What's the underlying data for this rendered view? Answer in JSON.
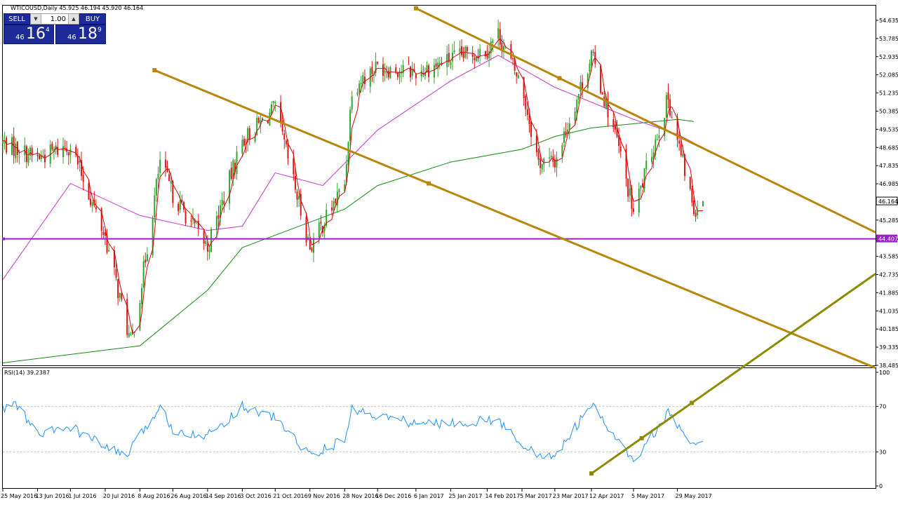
{
  "symbol_header": "WTICOUSD,Daily  45.925 46.194 45.920 46.164",
  "trade_panel": {
    "sell_label": "SELL",
    "buy_label": "BUY",
    "lot_value": "1.00",
    "sell_price": {
      "small": "46",
      "big": "16",
      "sup": "4"
    },
    "buy_price": {
      "small": "46",
      "big": "18",
      "sup": "9"
    }
  },
  "colors": {
    "bull_candle": "#2fa52f",
    "bear_candle": "#d71818",
    "fast_ma": "#e00000",
    "mid_ma": "#cc33cc",
    "slow_ma": "#138a13",
    "channel_lines": "#b8860b",
    "horizontal_level": "#9b1fc9",
    "rsi_line": "#1e90ff",
    "rsi_trendline": "#8b8b00",
    "current_price_label_bg": "#ffffff"
  },
  "chart_data": [
    {
      "type": "candlestick",
      "title": "WTICOUSD,Daily",
      "ohlc_header": {
        "open": 45.925,
        "high": 46.194,
        "low": 45.92,
        "close": 46.164
      },
      "x_tick_labels": [
        "25 May 2016",
        "13 Jun 2016",
        "1 Jul 2016",
        "20 Jul 2016",
        "8 Aug 2016",
        "26 Aug 2016",
        "14 Sep 2016",
        "3 Oct 2016",
        "21 Oct 2016",
        "9 Nov 2016",
        "28 Nov 2016",
        "16 Dec 2016",
        "6 Jan 2017",
        "25 Jan 2017",
        "14 Feb 2017",
        "5 Mar 2017",
        "23 Mar 2017",
        "12 Apr 2017",
        "5 May 2017",
        "29 May 2017"
      ],
      "y_tick_labels": [
        "54.635",
        "53.785",
        "52.935",
        "52.085",
        "51.235",
        "50.385",
        "49.535",
        "48.685",
        "47.835",
        "46.985",
        "46.135",
        "45.285",
        "44.435",
        "43.585",
        "42.735",
        "41.885",
        "41.035",
        "40.185",
        "39.335",
        "38.485"
      ],
      "ylim": [
        38.485,
        55.0
      ],
      "close_anchors": [
        {
          "date": "25 May 2016",
          "close": 48.9
        },
        {
          "date": "13 Jun 2016",
          "close": 48.2
        },
        {
          "date": "1 Jul 2016",
          "close": 48.8
        },
        {
          "date": "20 Jul 2016",
          "close": 44.5
        },
        {
          "date": "3 Aug 2016",
          "close": 39.5
        },
        {
          "date": "8 Aug 2016",
          "close": 41.8
        },
        {
          "date": "19 Aug 2016",
          "close": 48.0
        },
        {
          "date": "26 Aug 2016",
          "close": 46.5
        },
        {
          "date": "14 Sep 2016",
          "close": 44.0
        },
        {
          "date": "3 Oct 2016",
          "close": 49.0
        },
        {
          "date": "21 Oct 2016",
          "close": 50.5
        },
        {
          "date": "9 Nov 2016",
          "close": 44.0
        },
        {
          "date": "28 Nov 2016",
          "close": 47.0
        },
        {
          "date": "2 Dec 2016",
          "close": 51.5
        },
        {
          "date": "16 Dec 2016",
          "close": 52.5
        },
        {
          "date": "6 Jan 2017",
          "close": 52.2
        },
        {
          "date": "25 Jan 2017",
          "close": 52.8
        },
        {
          "date": "14 Feb 2017",
          "close": 53.3
        },
        {
          "date": "20 Feb 2017",
          "close": 54.0
        },
        {
          "date": "5 Mar 2017",
          "close": 51.5
        },
        {
          "date": "14 Mar 2017",
          "close": 48.0
        },
        {
          "date": "23 Mar 2017",
          "close": 48.0
        },
        {
          "date": "12 Apr 2017",
          "close": 53.0
        },
        {
          "date": "26 Apr 2017",
          "close": 49.0
        },
        {
          "date": "5 May 2017",
          "close": 45.6
        },
        {
          "date": "15 May 2017",
          "close": 48.5
        },
        {
          "date": "24 May 2017",
          "close": 51.0
        },
        {
          "date": "29 May 2017",
          "close": 49.0
        },
        {
          "date": "7 Jun 2017",
          "close": 45.8
        },
        {
          "date": "12 Jun 2017",
          "close": 46.164
        }
      ],
      "horizontal_level": {
        "value": 44.407,
        "label": "44.407"
      },
      "current_price": {
        "value": 46.164,
        "label": "46.164"
      },
      "channel_lines": [
        {
          "start": {
            "date": "16 Aug 2016",
            "price": 52.3
          },
          "end": {
            "date": "12 Jun 2017",
            "price": 41.7
          }
        },
        {
          "start": {
            "date": "6 Jan 2017",
            "price": 55.2
          },
          "end": {
            "date": "12 Jun 2017",
            "price": 48.65
          }
        }
      ],
      "moving_averages": [
        {
          "color_key": "fast_ma",
          "anchors": [
            {
              "date": "25 May 2016",
              "value": 48.7
            },
            {
              "date": "3 Aug 2016",
              "value": 40.2
            },
            {
              "date": "21 Oct 2016",
              "value": 50.2
            },
            {
              "date": "9 Nov 2016",
              "value": 44.5
            },
            {
              "date": "20 Feb 2017",
              "value": 53.6
            },
            {
              "date": "14 Mar 2017",
              "value": 48.2
            },
            {
              "date": "12 Apr 2017",
              "value": 52.8
            },
            {
              "date": "5 May 2017",
              "value": 46.0
            },
            {
              "date": "24 May 2017",
              "value": 50.5
            },
            {
              "date": "12 Jun 2017",
              "value": 46.0
            }
          ]
        },
        {
          "color_key": "mid_ma",
          "anchors": [
            {
              "date": "25 May 2016",
              "value": 42.5
            },
            {
              "date": "1 Jul 2016",
              "value": 47.0
            },
            {
              "date": "8 Aug 2016",
              "value": 45.5
            },
            {
              "date": "14 Sep 2016",
              "value": 44.8
            },
            {
              "date": "3 Oct 2016",
              "value": 45.0
            },
            {
              "date": "21 Oct 2016",
              "value": 47.5
            },
            {
              "date": "16 Nov 2016",
              "value": 46.9
            },
            {
              "date": "16 Dec 2016",
              "value": 49.5
            },
            {
              "date": "25 Jan 2017",
              "value": 51.8
            },
            {
              "date": "20 Feb 2017",
              "value": 53.0
            },
            {
              "date": "23 Mar 2017",
              "value": 51.5
            },
            {
              "date": "5 May 2017",
              "value": 50.0
            },
            {
              "date": "29 May 2017",
              "value": 49.3
            },
            {
              "date": "7 Jun 2017",
              "value": 48.9
            }
          ]
        },
        {
          "color_key": "slow_ma",
          "anchors": [
            {
              "date": "25 May 2016",
              "value": 38.6
            },
            {
              "date": "8 Aug 2016",
              "value": 39.4
            },
            {
              "date": "14 Sep 2016",
              "value": 42.0
            },
            {
              "date": "3 Oct 2016",
              "value": 44.0
            },
            {
              "date": "28 Nov 2016",
              "value": 45.8
            },
            {
              "date": "16 Dec 2016",
              "value": 46.9
            },
            {
              "date": "25 Jan 2017",
              "value": 48.0
            },
            {
              "date": "5 Mar 2017",
              "value": 48.6
            },
            {
              "date": "23 Mar 2017",
              "value": 49.2
            },
            {
              "date": "12 Apr 2017",
              "value": 49.6
            },
            {
              "date": "29 May 2017",
              "value": 50.0
            },
            {
              "date": "7 Jun 2017",
              "value": 49.9
            }
          ]
        }
      ]
    },
    {
      "type": "line",
      "title": "RSI(14) 39.2387",
      "ylim": [
        0,
        100
      ],
      "y_tick_labels": [
        "100",
        "70",
        "30",
        "0"
      ],
      "levels": [
        70,
        30
      ],
      "series": [
        {
          "name": "RSI(14)",
          "anchors": [
            {
              "date": "25 May 2016",
              "value": 67
            },
            {
              "date": "1 Jun 2016",
              "value": 73
            },
            {
              "date": "13 Jun 2016",
              "value": 45
            },
            {
              "date": "1 Jul 2016",
              "value": 52
            },
            {
              "date": "20 Jul 2016",
              "value": 34
            },
            {
              "date": "1 Aug 2016",
              "value": 27
            },
            {
              "date": "19 Aug 2016",
              "value": 70
            },
            {
              "date": "26 Aug 2016",
              "value": 50
            },
            {
              "date": "14 Sep 2016",
              "value": 44
            },
            {
              "date": "3 Oct 2016",
              "value": 70
            },
            {
              "date": "21 Oct 2016",
              "value": 60
            },
            {
              "date": "9 Nov 2016",
              "value": 27
            },
            {
              "date": "28 Nov 2016",
              "value": 40
            },
            {
              "date": "2 Dec 2016",
              "value": 68
            },
            {
              "date": "16 Dec 2016",
              "value": 62
            },
            {
              "date": "6 Jan 2017",
              "value": 55
            },
            {
              "date": "25 Jan 2017",
              "value": 55
            },
            {
              "date": "14 Feb 2017",
              "value": 58
            },
            {
              "date": "20 Feb 2017",
              "value": 57
            },
            {
              "date": "14 Mar 2017",
              "value": 25
            },
            {
              "date": "23 Mar 2017",
              "value": 27
            },
            {
              "date": "12 Apr 2017",
              "value": 71
            },
            {
              "date": "26 Apr 2017",
              "value": 40
            },
            {
              "date": "5 May 2017",
              "value": 21
            },
            {
              "date": "24 May 2017",
              "value": 64
            },
            {
              "date": "29 May 2017",
              "value": 52
            },
            {
              "date": "7 Jun 2017",
              "value": 35
            },
            {
              "date": "12 Jun 2017",
              "value": 39.2387
            }
          ]
        }
      ],
      "trendline": {
        "start": {
          "date": "12 Apr 2017",
          "value": 11
        },
        "end": {
          "date": "12 Jun 2017",
          "value": 80
        }
      }
    }
  ]
}
